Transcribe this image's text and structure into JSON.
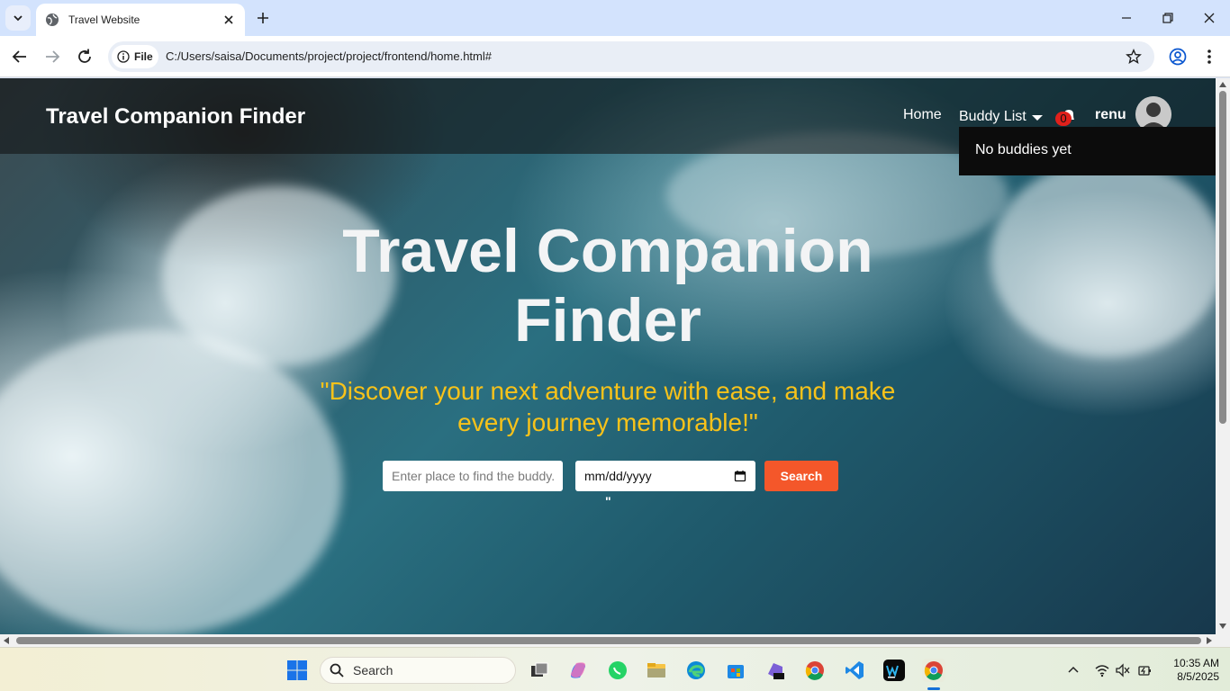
{
  "browser": {
    "tab_title": "Travel Website",
    "file_chip_label": "File",
    "url": "C:/Users/saisa/Documents/project/project/frontend/home.html#"
  },
  "navbar": {
    "brand": "Travel Companion Finder",
    "home_link": "Home",
    "buddy_list_label": "Buddy List",
    "notification_count": "0",
    "username": "renu",
    "dropdown_message": "No buddies yet"
  },
  "hero": {
    "title": "Travel Companion Finder",
    "tagline": "\"Discover your next adventure with ease, and make every journey memorable!\"",
    "search_placeholder": "Enter place to find the buddy...",
    "date_placeholder": "mm/dd/yyyy",
    "search_button": "Search",
    "stray_text": "\""
  },
  "taskbar": {
    "search_label": "Search",
    "time": "10:35 AM",
    "date": "8/5/2025"
  },
  "colors": {
    "accent_button": "#f4572a",
    "tagline": "#f7c21a",
    "badge": "#e0201b"
  }
}
